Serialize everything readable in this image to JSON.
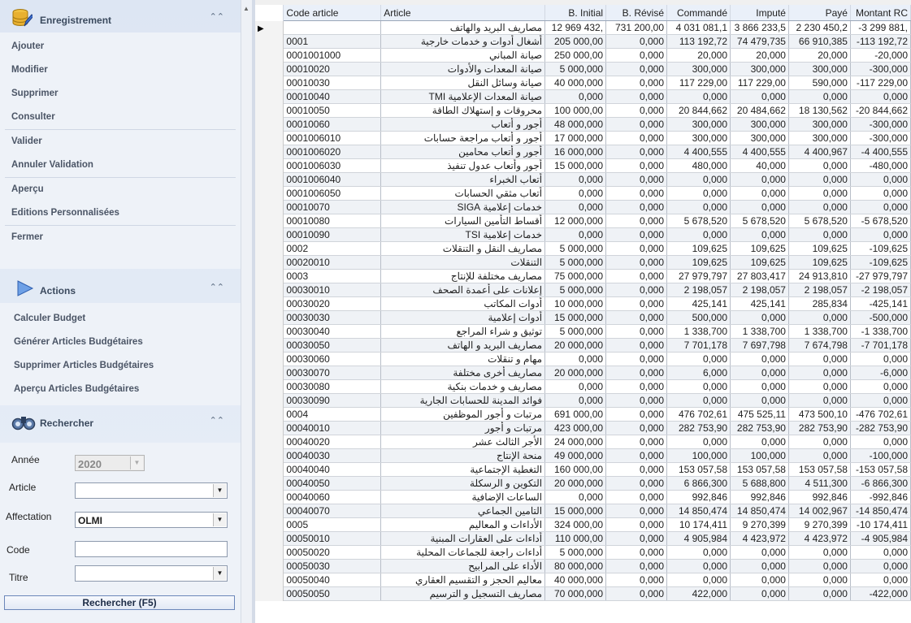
{
  "panel": {
    "enregistrement": {
      "title": "Enregistrement",
      "items": [
        "Ajouter",
        "Modifier",
        "Supprimer",
        "Consulter",
        "Valider",
        "Annuler Validation",
        "Aperçu",
        "Editions Personnalisées",
        "Fermer"
      ]
    },
    "actions": {
      "title": "Actions",
      "items": [
        "Calculer Budget",
        "Générer Articles Budgétaires",
        "Supprimer Articles Budgétaires",
        "Aperçu Articles Budgétaires"
      ]
    },
    "rechercher": {
      "title": "Rechercher",
      "annee_label": "Année",
      "annee_value": "2020",
      "article_label": "Article",
      "article_value": "",
      "affectation_label": "Affectation",
      "affectation_value": "OLMI",
      "code_label": "Code",
      "code_value": "",
      "titre_label": "Titre",
      "titre_value": "",
      "button": "Rechercher (F5)"
    }
  },
  "grid": {
    "columns": [
      "Code article",
      "Article",
      "B. Initial",
      "B. Révisé",
      "Commandé",
      "Imputé",
      "Payé",
      "Montant RC"
    ],
    "rows": [
      [
        "",
        "مصاريف البريد والهاتف",
        "12 969 432,",
        "731 200,00",
        "4 031 081,1",
        "3 866 233,5",
        "2 230 450,2",
        "-3 299 881,"
      ],
      [
        "0001",
        "أشغال أدوات و خدمات خارجية",
        "205 000,00",
        "0,000",
        "113 192,72",
        "74 479,735",
        "66 910,385",
        "-113 192,72"
      ],
      [
        "0001001000",
        "صيانة المباني",
        "250 000,00",
        "0,000",
        "20,000",
        "20,000",
        "20,000",
        "-20,000"
      ],
      [
        "00010020",
        "صيانة المعدات والأدوات",
        "5 000,000",
        "0,000",
        "300,000",
        "300,000",
        "300,000",
        "-300,000"
      ],
      [
        "00010030",
        "صيانة وسائل النقل",
        "40 000,000",
        "0,000",
        "117 229,00",
        "117 229,00",
        "590,000",
        "-117 229,00"
      ],
      [
        "00010040",
        "صيانة المعدات الإعلامية TMI",
        "0,000",
        "0,000",
        "0,000",
        "0,000",
        "0,000",
        "0,000"
      ],
      [
        "00010050",
        "محروقات و إستهلاك الطاقة",
        "100 000,00",
        "0,000",
        "20 844,662",
        "20 484,662",
        "18 130,562",
        "-20 844,662"
      ],
      [
        "00010060",
        "أجور و أتعاب",
        "48 000,000",
        "0,000",
        "300,000",
        "300,000",
        "300,000",
        "-300,000"
      ],
      [
        "0001006010",
        "أجور و أتعاب مراجعة حسابات",
        "17 000,000",
        "0,000",
        "300,000",
        "300,000",
        "300,000",
        "-300,000"
      ],
      [
        "0001006020",
        "أجور و أتعاب محامين",
        "16 000,000",
        "0,000",
        "4 400,555",
        "4 400,555",
        "4 400,967",
        "-4 400,555"
      ],
      [
        "0001006030",
        "أجور وأتعاب عدول تنفيذ",
        "15 000,000",
        "0,000",
        "480,000",
        "40,000",
        "0,000",
        "-480,000"
      ],
      [
        "0001006040",
        "أتعاب الخبراء",
        "0,000",
        "0,000",
        "0,000",
        "0,000",
        "0,000",
        "0,000"
      ],
      [
        "0001006050",
        "أتعاب مثقي الحسابات",
        "0,000",
        "0,000",
        "0,000",
        "0,000",
        "0,000",
        "0,000"
      ],
      [
        "00010070",
        "خدمات إعلامية SIGA",
        "0,000",
        "0,000",
        "0,000",
        "0,000",
        "0,000",
        "0,000"
      ],
      [
        "00010080",
        "أقساط التأمين السيارات",
        "12 000,000",
        "0,000",
        "5 678,520",
        "5 678,520",
        "5 678,520",
        "-5 678,520"
      ],
      [
        "00010090",
        "خدمات إعلامية TSI",
        "0,000",
        "0,000",
        "0,000",
        "0,000",
        "0,000",
        "0,000"
      ],
      [
        "0002",
        "مصاريف النقل و التنقلات",
        "5 000,000",
        "0,000",
        "109,625",
        "109,625",
        "109,625",
        "-109,625"
      ],
      [
        "00020010",
        "التنقلات",
        "5 000,000",
        "0,000",
        "109,625",
        "109,625",
        "109,625",
        "-109,625"
      ],
      [
        "0003",
        "مصاريف مختلفة للإنتاج",
        "75 000,000",
        "0,000",
        "27 979,797",
        "27 803,417",
        "24 913,810",
        "-27 979,797"
      ],
      [
        "00030010",
        "إعلانات على أعمدة الصحف",
        "5 000,000",
        "0,000",
        "2 198,057",
        "2 198,057",
        "2 198,057",
        "-2 198,057"
      ],
      [
        "00030020",
        "أدوات المكاتب",
        "10 000,000",
        "0,000",
        "425,141",
        "425,141",
        "285,834",
        "-425,141"
      ],
      [
        "00030030",
        "أدوات إعلامية",
        "15 000,000",
        "0,000",
        "500,000",
        "0,000",
        "0,000",
        "-500,000"
      ],
      [
        "00030040",
        "توثيق و شراء المراجع",
        "5 000,000",
        "0,000",
        "1 338,700",
        "1 338,700",
        "1 338,700",
        "-1 338,700"
      ],
      [
        "00030050",
        "مصاريف البريد و الهاتف",
        "20 000,000",
        "0,000",
        "7 701,178",
        "7 697,798",
        "7 674,798",
        "-7 701,178"
      ],
      [
        "00030060",
        "مهام و تنقلات",
        "0,000",
        "0,000",
        "0,000",
        "0,000",
        "0,000",
        "0,000"
      ],
      [
        "00030070",
        "مصاريف أخرى مختلفة",
        "20 000,000",
        "0,000",
        "6,000",
        "0,000",
        "0,000",
        "-6,000"
      ],
      [
        "00030080",
        "مصاريف و خدمات بنكية",
        "0,000",
        "0,000",
        "0,000",
        "0,000",
        "0,000",
        "0,000"
      ],
      [
        "00030090",
        "فوائد المدينة للحسابات الجارية",
        "0,000",
        "0,000",
        "0,000",
        "0,000",
        "0,000",
        "0,000"
      ],
      [
        "0004",
        "مرتبات و أجور الموظفين",
        "691 000,00",
        "0,000",
        "476 702,61",
        "475 525,11",
        "473 500,10",
        "-476 702,61"
      ],
      [
        "00040010",
        "مرتبات و أجور",
        "423 000,00",
        "0,000",
        "282 753,90",
        "282 753,90",
        "282 753,90",
        "-282 753,90"
      ],
      [
        "00040020",
        "الأجر الثالث عشر",
        "24 000,000",
        "0,000",
        "0,000",
        "0,000",
        "0,000",
        "0,000"
      ],
      [
        "00040030",
        "منحة الإنتاج",
        "49 000,000",
        "0,000",
        "100,000",
        "100,000",
        "0,000",
        "-100,000"
      ],
      [
        "00040040",
        "التغطية الإجتماعية",
        "160 000,00",
        "0,000",
        "153 057,58",
        "153 057,58",
        "153 057,58",
        "-153 057,58"
      ],
      [
        "00040050",
        "التكوين و الرسكلة",
        "20 000,000",
        "0,000",
        "6 866,300",
        "5 688,800",
        "4 511,300",
        "-6 866,300"
      ],
      [
        "00040060",
        "الساعات الإضافية",
        "0,000",
        "0,000",
        "992,846",
        "992,846",
        "992,846",
        "-992,846"
      ],
      [
        "00040070",
        "التامين الجماعي",
        "15 000,000",
        "0,000",
        "14 850,474",
        "14 850,474",
        "14 002,967",
        "-14 850,474"
      ],
      [
        "0005",
        "الأداءات و المعاليم",
        "324 000,00",
        "0,000",
        "10 174,411",
        "9 270,399",
        "9 270,399",
        "-10 174,411"
      ],
      [
        "00050010",
        "أداءات على العقارات المبنية",
        "110 000,00",
        "0,000",
        "4 905,984",
        "4 423,972",
        "4 423,972",
        "-4 905,984"
      ],
      [
        "00050020",
        "أداءات راجعة للجماعات المحلية",
        "5 000,000",
        "0,000",
        "0,000",
        "0,000",
        "0,000",
        "0,000"
      ],
      [
        "00050030",
        "الأداء على المرابيح",
        "80 000,000",
        "0,000",
        "0,000",
        "0,000",
        "0,000",
        "0,000"
      ],
      [
        "00050040",
        "معاليم الحجز و التقسيم العقاري",
        "40 000,000",
        "0,000",
        "0,000",
        "0,000",
        "0,000",
        "0,000"
      ],
      [
        "00050050",
        "مصاريف التسجيل و الترسيم",
        "70 000,000",
        "0,000",
        "422,000",
        "0,000",
        "0,000",
        "-422,000"
      ]
    ]
  }
}
